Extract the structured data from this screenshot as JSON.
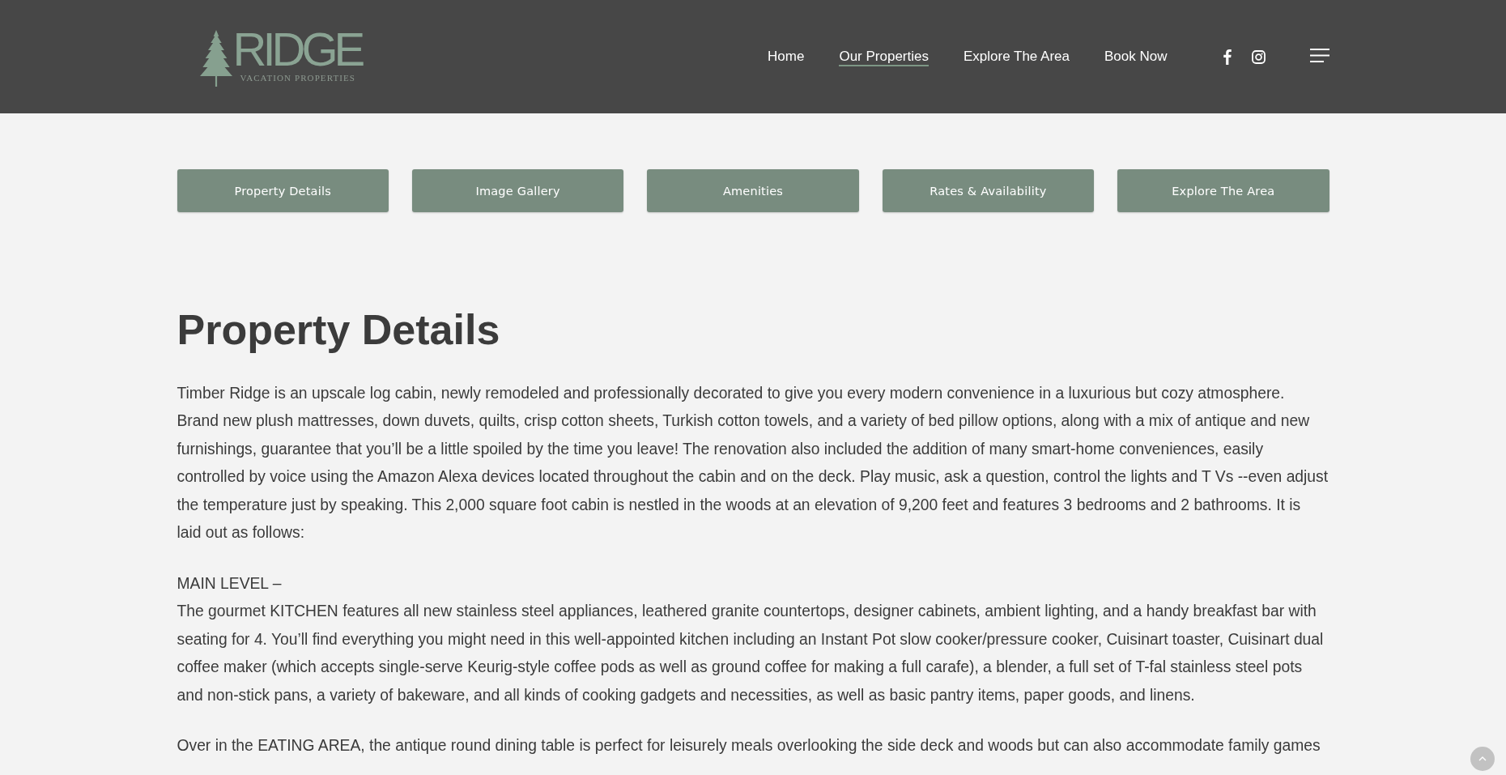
{
  "header": {
    "logo": {
      "wordmark": "RIDGE",
      "tagline": "VACATION PROPERTIES"
    },
    "nav": [
      {
        "label": "Home",
        "selected": false
      },
      {
        "label": "Our Properties",
        "selected": true
      },
      {
        "label": "Explore The Area",
        "selected": false
      },
      {
        "label": "Book Now",
        "selected": false
      }
    ]
  },
  "section_tabs": [
    {
      "label": "Property Details"
    },
    {
      "label": "Image Gallery"
    },
    {
      "label": "Amenities"
    },
    {
      "label": "Rates & Availability"
    },
    {
      "label": "Explore The Area"
    }
  ],
  "content": {
    "title": "Property Details",
    "blocks": [
      {
        "text": "Timber Ridge is an upscale log cabin, newly remodeled and professionally decorated to give you every modern convenience in a luxurious but cozy atmosphere. Brand new plush mattresses, down duvets, quilts, crisp cotton sheets, Turkish cotton towels, and a variety of bed pillow options, along with a mix of antique and new furnishings, guarantee that you’ll be a little spoiled by the time you leave! The renovation also included the addition of many smart-home conveniences, easily controlled by voice using the Amazon Alexa devices located throughout the cabin and on the deck. Play music, ask a question, control the lights and T Vs --even adjust the temperature just by speaking. This 2,000 square foot cabin is nestled in the woods at an elevation of 9,200 feet and features 3 bedrooms and 2 bathrooms. It is laid out as follows:"
      },
      {
        "heading": "MAIN LEVEL –",
        "text": "The gourmet KITCHEN features all new stainless steel appliances, leathered granite countertops, designer cabinets, ambient lighting, and a handy breakfast bar with seating for 4. You’ll find everything you might need in this well-appointed kitchen including an Instant Pot slow cooker/pressure cooker, Cuisinart toaster, Cuisinart dual coffee maker (which accepts single-serve Keurig-style coffee pods as well as ground coffee for making a full carafe), a blender, a full set of T-fal stainless steel pots and non-stick pans, a variety of bakeware, and all kinds of cooking gadgets and necessities, as well as basic pantry items, paper goods, and linens."
      },
      {
        "text": "Over in the EATING AREA, the antique round dining table is perfect for leisurely meals overlooking the side deck and woods but can also accommodate family games"
      }
    ]
  }
}
